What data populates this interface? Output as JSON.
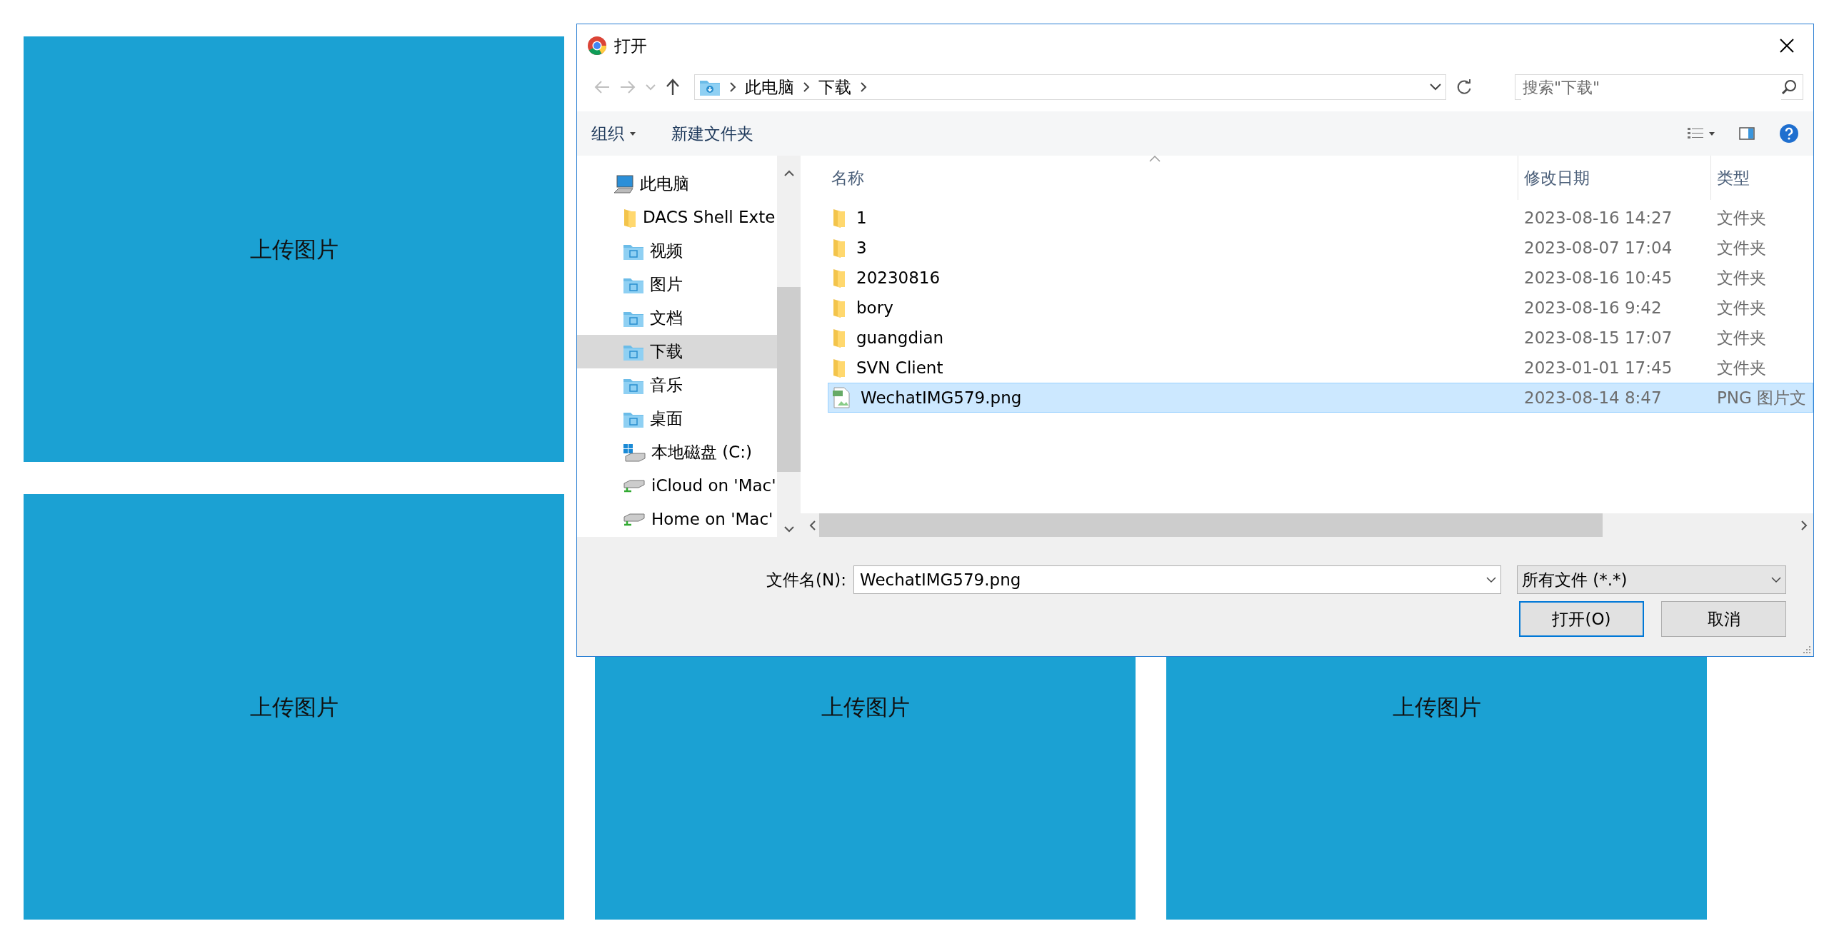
{
  "tiles": [
    {
      "label": "上传图片"
    },
    {
      "label": "上传图片"
    },
    {
      "label": "上传图片"
    },
    {
      "label": "上传图片"
    }
  ],
  "dialog": {
    "title": "打开",
    "address": {
      "segments": [
        "此电脑",
        "下载"
      ]
    },
    "search": {
      "placeholder": "搜索\"下载\""
    },
    "toolbar": {
      "organize": "组织",
      "new_folder": "新建文件夹"
    },
    "sidebar": {
      "items": [
        {
          "label": "此电脑",
          "kind": "computer",
          "selected": false,
          "children": [
            {
              "label": "DACS Shell Exte",
              "kind": "folder",
              "selected": false
            },
            {
              "label": "视频",
              "kind": "library",
              "selected": false
            },
            {
              "label": "图片",
              "kind": "library",
              "selected": false
            },
            {
              "label": "文档",
              "kind": "library",
              "selected": false
            },
            {
              "label": "下载",
              "kind": "library",
              "selected": true
            },
            {
              "label": "音乐",
              "kind": "library",
              "selected": false
            },
            {
              "label": "桌面",
              "kind": "library",
              "selected": false
            },
            {
              "label": "本地磁盘 (C:)",
              "kind": "drive",
              "selected": false
            },
            {
              "label": "iCloud on 'Mac'",
              "kind": "network",
              "selected": false
            },
            {
              "label": "Home on 'Mac'",
              "kind": "network",
              "selected": false
            }
          ]
        }
      ]
    },
    "columns": [
      "名称",
      "修改日期",
      "类型"
    ],
    "files": [
      {
        "name": "1",
        "modified": "2023-08-16 14:27",
        "type": "文件夹",
        "kind": "folder",
        "selected": false
      },
      {
        "name": "3",
        "modified": "2023-08-07 17:04",
        "type": "文件夹",
        "kind": "folder",
        "selected": false
      },
      {
        "name": "20230816",
        "modified": "2023-08-16 10:45",
        "type": "文件夹",
        "kind": "folder",
        "selected": false
      },
      {
        "name": "bory",
        "modified": "2023-08-16 9:42",
        "type": "文件夹",
        "kind": "folder",
        "selected": false
      },
      {
        "name": "guangdian",
        "modified": "2023-08-15 17:07",
        "type": "文件夹",
        "kind": "folder",
        "selected": false
      },
      {
        "name": "SVN Client",
        "modified": "2023-01-01 17:45",
        "type": "文件夹",
        "kind": "folder",
        "selected": false
      },
      {
        "name": "WechatIMG579.png",
        "modified": "2023-08-14 8:47",
        "type": "PNG 图片文",
        "kind": "image",
        "selected": true
      }
    ],
    "file_name": {
      "label": "文件名(N):",
      "value": "WechatIMG579.png"
    },
    "filter": "所有文件 (*.*)",
    "buttons": [
      {
        "label": "打开(O)",
        "default": true
      },
      {
        "label": "取消",
        "default": false
      }
    ]
  }
}
